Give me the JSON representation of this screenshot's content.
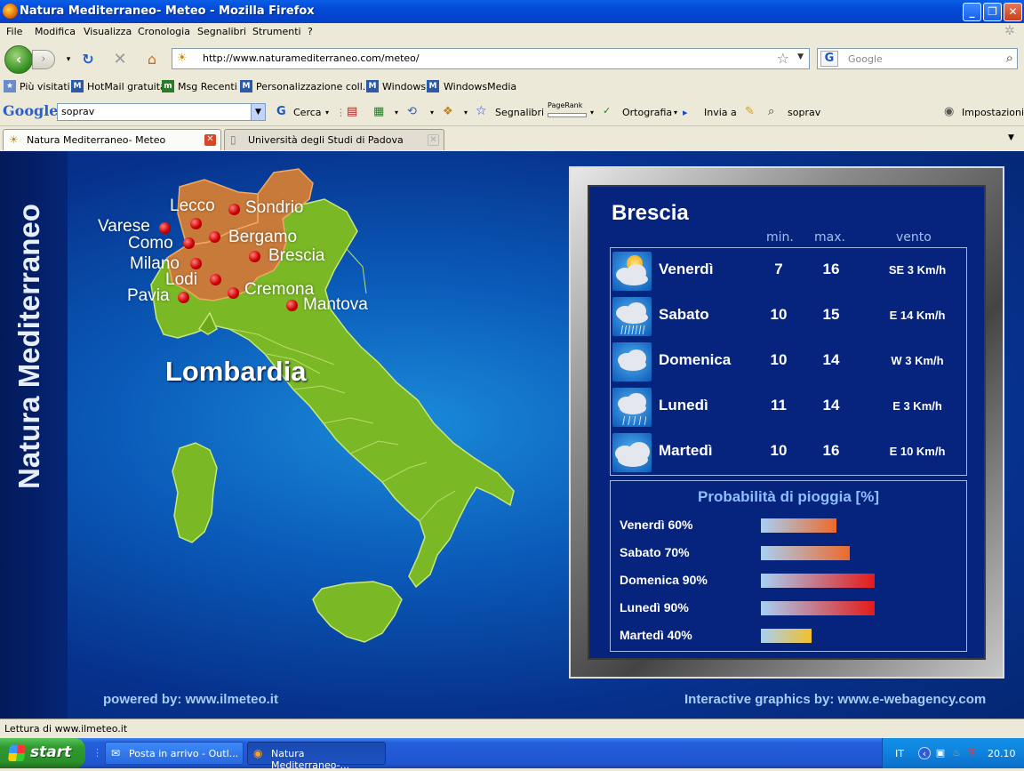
{
  "window": {
    "title": "Natura Mediterraneo- Meteo - Mozilla Firefox",
    "minimize": "_",
    "maximize": "❐",
    "close": "✕"
  },
  "menu": [
    "File",
    "Modifica",
    "Visualizza",
    "Cronologia",
    "Segnalibri",
    "Strumenti",
    "?"
  ],
  "nav": {
    "url": "http://www.naturamediterraneo.com/meteo/",
    "search_placeholder": "Google",
    "search_engine": "G"
  },
  "bookmarks": [
    "Più visitati",
    "HotMail gratuita",
    "Msg Recenti",
    "Personalizzazione coll...",
    "Windows",
    "WindowsMedia"
  ],
  "google_toolbar": {
    "logo": "Google",
    "query": "soprav",
    "cerca": "Cerca",
    "segnalibri": "Segnalibri",
    "pagerank": "PageRank",
    "ortografia": "Ortografia",
    "invia": "Invia a",
    "soprav": "soprav",
    "impostazioni": "Impostazioni"
  },
  "tabs": [
    {
      "label": "Natura Mediterraneo- Meteo",
      "active": true
    },
    {
      "label": "Università degli Studi di Padova",
      "active": false
    }
  ],
  "page": {
    "side_title": "Natura Mediterraneo",
    "region": "Lombardia",
    "cities": [
      "Lecco",
      "Sondrio",
      "Varese",
      "Como",
      "Bergamo",
      "Milano",
      "Brescia",
      "Lodi",
      "Pavia",
      "Cremona",
      "Mantova"
    ],
    "forecast_city": "Brescia",
    "col_min": "min.",
    "col_max": "max.",
    "col_wind": "vento",
    "forecast": [
      {
        "day": "Venerdì",
        "min": "7",
        "max": "16",
        "wind": "SE  3 Km/h",
        "icon": "sun-cloud-icon"
      },
      {
        "day": "Sabato",
        "min": "10",
        "max": "15",
        "wind": "E  14 Km/h",
        "icon": "rain-cloud-icon"
      },
      {
        "day": "Domenica",
        "min": "10",
        "max": "14",
        "wind": "W  3 Km/h",
        "icon": "cloud-icon"
      },
      {
        "day": "Lunedì",
        "min": "11",
        "max": "14",
        "wind": "E  3 Km/h",
        "icon": "rain-cloud-icon"
      },
      {
        "day": "Martedì",
        "min": "10",
        "max": "16",
        "wind": "E  10 Km/h",
        "icon": "cloud-icon"
      }
    ],
    "rain_title": "Probabilità di pioggia [%]",
    "rain": [
      {
        "label": "Venerdì 60%",
        "value": 60
      },
      {
        "label": "Sabato 70%",
        "value": 70
      },
      {
        "label": "Domenica 90%",
        "value": 90
      },
      {
        "label": "Lunedì 90%",
        "value": 90
      },
      {
        "label": "Martedì 40%",
        "value": 40
      }
    ],
    "footer_left": "powered by: www.ilmeteo.it",
    "footer_right": "Interactive graphics by: www.e-webagency.com"
  },
  "status": "Lettura di www.ilmeteo.it",
  "taskbar": {
    "start": "start",
    "tasks": [
      "Posta in arrivo - Outl...",
      "Natura Mediterraneo-..."
    ],
    "lang": "IT",
    "clock": "20.10"
  }
}
